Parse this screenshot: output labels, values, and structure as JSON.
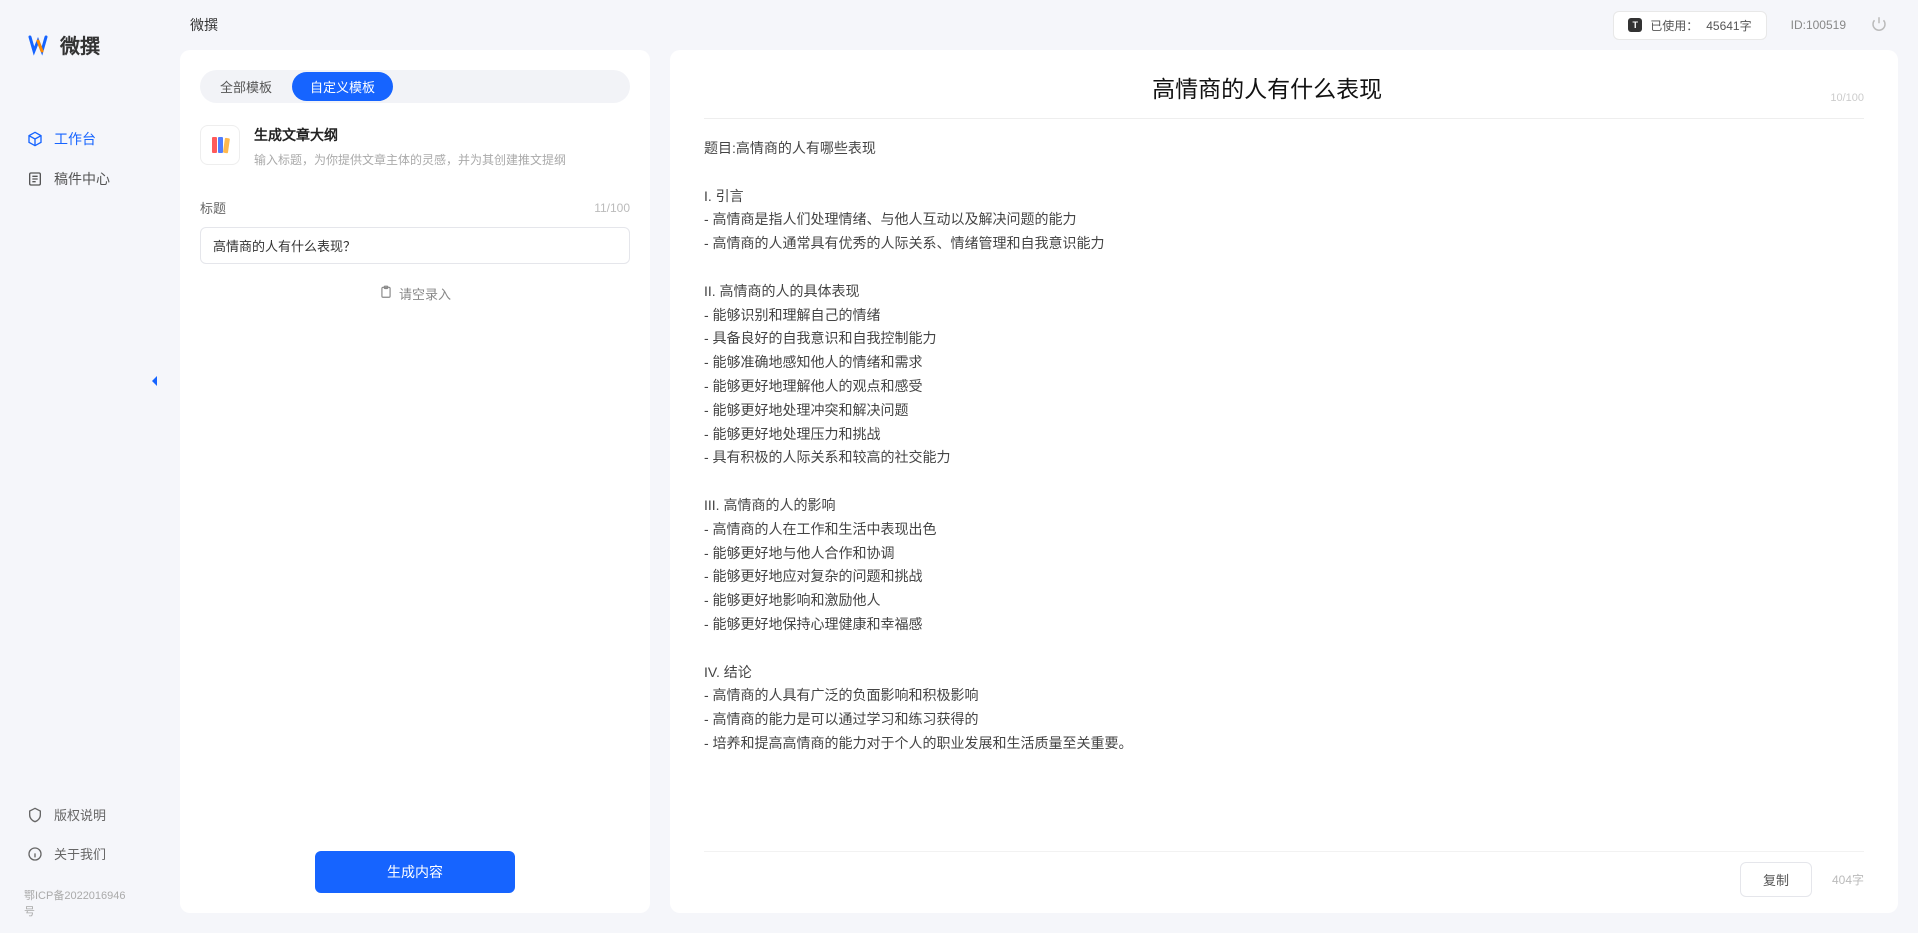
{
  "sidebar": {
    "logo_text": "微撰",
    "nav": [
      {
        "label": "工作台",
        "active": true
      },
      {
        "label": "稿件中心",
        "active": false
      }
    ],
    "bottom": [
      {
        "label": "版权说明"
      },
      {
        "label": "关于我们"
      }
    ],
    "icp": "鄂ICP备2022016946号"
  },
  "topbar": {
    "title": "微撰",
    "usage_label": "已使用：",
    "usage_value": "45641字",
    "id_label": "ID:100519"
  },
  "left_panel": {
    "tabs": [
      {
        "label": "全部模板",
        "active": false
      },
      {
        "label": "自定义模板",
        "active": true
      }
    ],
    "template": {
      "title": "生成文章大纲",
      "desc": "输入标题，为你提供文章主体的灵感，并为其创建推文提纲"
    },
    "field": {
      "label": "标题",
      "counter": "11/100",
      "value": "高情商的人有什么表现？"
    },
    "fill_link": "请空录入",
    "generate_label": "生成内容"
  },
  "right_panel": {
    "title": "高情商的人有什么表现",
    "head_counter": "10/100",
    "body": "题目:高情商的人有哪些表现\n\nI. 引言\n- 高情商是指人们处理情绪、与他人互动以及解决问题的能力\n- 高情商的人通常具有优秀的人际关系、情绪管理和自我意识能力\n\nII. 高情商的人的具体表现\n- 能够识别和理解自己的情绪\n- 具备良好的自我意识和自我控制能力\n- 能够准确地感知他人的情绪和需求\n- 能够更好地理解他人的观点和感受\n- 能够更好地处理冲突和解决问题\n- 能够更好地处理压力和挑战\n- 具有积极的人际关系和较高的社交能力\n\nIII. 高情商的人的影响\n- 高情商的人在工作和生活中表现出色\n- 能够更好地与他人合作和协调\n- 能够更好地应对复杂的问题和挑战\n- 能够更好地影响和激励他人\n- 能够更好地保持心理健康和幸福感\n\nIV. 结论\n- 高情商的人具有广泛的负面影响和积极影响\n- 高情商的能力是可以通过学习和练习获得的\n- 培养和提高高情商的能力对于个人的职业发展和生活质量至关重要。",
    "copy_label": "复制",
    "word_count": "404字"
  }
}
